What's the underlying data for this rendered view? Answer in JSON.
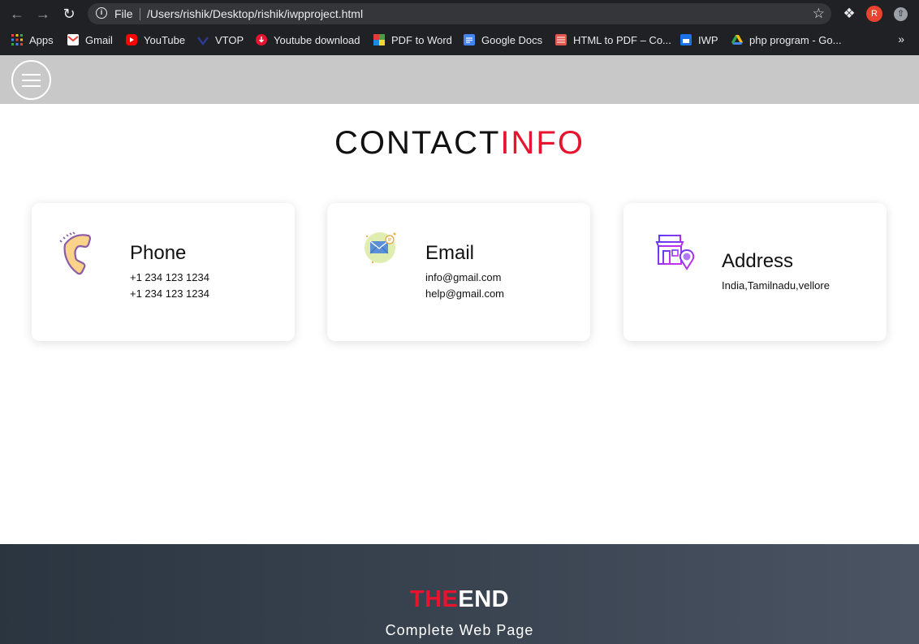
{
  "browser": {
    "omnibox_scheme": "File",
    "url": "/Users/rishik/Desktop/rishik/iwpproject.html",
    "profile_initial": "R",
    "bookmarks": [
      {
        "label": "Apps",
        "icon": "apps-grid-icon"
      },
      {
        "label": "Gmail",
        "icon": "gmail-icon"
      },
      {
        "label": "YouTube",
        "icon": "youtube-icon"
      },
      {
        "label": "VTOP",
        "icon": "vtop-icon"
      },
      {
        "label": "Youtube download",
        "icon": "youtube-download-icon"
      },
      {
        "label": "PDF to Word",
        "icon": "pdf-to-word-icon"
      },
      {
        "label": "Google Docs",
        "icon": "google-docs-icon"
      },
      {
        "label": "HTML to PDF – Co...",
        "icon": "html-to-pdf-icon"
      },
      {
        "label": "IWP",
        "icon": "iwp-icon"
      },
      {
        "label": "php program - Go...",
        "icon": "google-drive-icon"
      }
    ],
    "more_bookmarks": "»"
  },
  "page": {
    "title_main": "CONTACT",
    "title_accent": "INFO",
    "accent_color": "#e8132f",
    "cards": [
      {
        "heading": "Phone",
        "lines": [
          "+1 234 123 1234",
          "+1 234 123 1234"
        ],
        "icon": "phone-icon"
      },
      {
        "heading": "Email",
        "lines": [
          "info@gmail.com",
          "help@gmail.com"
        ],
        "icon": "email-icon"
      },
      {
        "heading": "Address",
        "lines": [
          "India,Tamilnadu,vellore"
        ],
        "icon": "address-icon"
      }
    ]
  },
  "footer": {
    "title_accent": "THE",
    "title_main": "END",
    "subtitle": "Complete Web Page"
  }
}
